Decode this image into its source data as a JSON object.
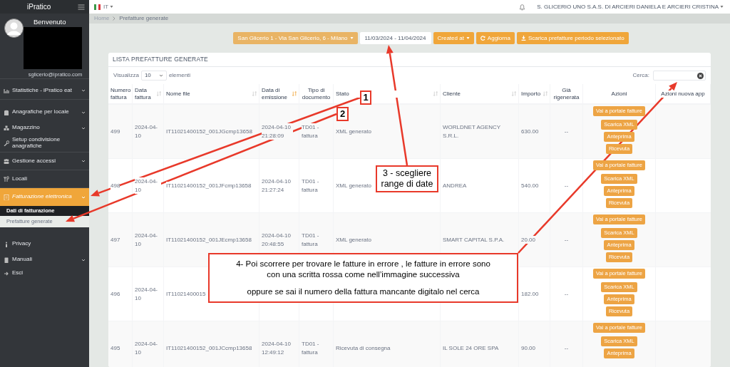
{
  "sidebar": {
    "logo": "iPratico",
    "welcome": "Benvenuto",
    "email": "sglicerio@ipratico.com",
    "items": [
      {
        "label": "Statistiche - iPratico eat",
        "has_submenu": true,
        "selected": false
      },
      {
        "label": "Anagrafiche per locale",
        "has_submenu": true,
        "selected": false
      },
      {
        "label": "Magazzino",
        "has_submenu": true,
        "selected": false
      },
      {
        "label": "Setup condivisione anagrafiche",
        "has_submenu": false,
        "selected": false
      },
      {
        "label": "Gestione accessi",
        "has_submenu": true,
        "selected": false
      },
      {
        "label": "Locali",
        "has_submenu": false,
        "selected": false
      },
      {
        "label": "Fatturazione elettronica",
        "has_submenu": true,
        "selected": true,
        "children": [
          {
            "label": "Dati di fatturazione",
            "selected": false
          },
          {
            "label": "Prefatture generate",
            "selected": true
          }
        ]
      },
      {
        "label": "Privacy",
        "has_submenu": false,
        "selected": false
      },
      {
        "label": "Manuali",
        "has_submenu": true,
        "selected": false
      },
      {
        "label": "Esci",
        "has_submenu": false,
        "selected": false
      }
    ]
  },
  "topbar": {
    "language": "IT",
    "company": "S. GLICERIO UNO S.A.S. DI ARCIERI DANIELA E ARCIERI CRISTINA"
  },
  "breadcrumb": [
    "Home",
    "Prefatture generate"
  ],
  "toolbar": {
    "location": "San Glicerio 1 - Via San Glicerio, 6 - Milano",
    "date_range": "11/03/2024 - 11/04/2024",
    "sort": "Created at",
    "refresh": "Aggiorna",
    "download": "Scarica prefatture periodo selezionato"
  },
  "card": {
    "title": "LISTA PREFATTURE GENERATE",
    "show_label": "Visualizza",
    "page_size": "10",
    "entries_label": "elementi",
    "search_label": "Cerca:",
    "columns": [
      {
        "label": "Numero fattura",
        "sortable": false,
        "sorted": false
      },
      {
        "label": "Data fattura",
        "sortable": true,
        "sorted": false
      },
      {
        "label": "Nome file",
        "sortable": true,
        "sorted": false
      },
      {
        "label": "Data di emissione",
        "sortable": true,
        "sorted": true
      },
      {
        "label": "Tipo di documento",
        "sortable": false,
        "sorted": false
      },
      {
        "label": "Stato",
        "sortable": true,
        "sorted": false
      },
      {
        "label": "Cliente",
        "sortable": true,
        "sorted": false
      },
      {
        "label": "Importo",
        "sortable": true,
        "sorted": false
      },
      {
        "label": "Già rigenerata",
        "sortable": false,
        "sorted": false
      },
      {
        "label": "Azioni",
        "sortable": false,
        "sorted": false
      },
      {
        "label": "Azioni nuova app",
        "sortable": false,
        "sorted": false
      }
    ],
    "rows": [
      {
        "cells": [
          "499",
          "2024-04-10",
          "IT11021400152_001JGcmp13658",
          "2024-04-10 21:28:09",
          "TD01 - fattura",
          "XML generato",
          "WORLDNET AGENCY S.R.L.",
          "630.00",
          "--"
        ],
        "actions": [
          "Vai a portale fatture",
          "Scarica XML",
          "Anteprima",
          "Ricevuta"
        ]
      },
      {
        "cells": [
          "498",
          "2024-04-10",
          "IT11021400152_001JFcmp13658",
          "2024-04-10 21:27:24",
          "TD01 - fattura",
          "XML generato",
          "ANDREA",
          "540.00",
          "--"
        ],
        "actions": [
          "Vai a portale fatture",
          "Scarica XML",
          "Anteprima",
          "Ricevuta"
        ]
      },
      {
        "cells": [
          "497",
          "2024-04-10",
          "IT11021400152_001JEcmp13658",
          "2024-04-10 20:48:55",
          "TD01 - fattura",
          "XML generato",
          "SMART CAPITAL S.P.A.",
          "20.00",
          "--"
        ],
        "actions": [
          "Vai a portale fatture",
          "Scarica XML",
          "Anteprima",
          "Ricevuta"
        ]
      },
      {
        "cells": [
          "496",
          "2024-04-10",
          "IT11021400015",
          null,
          null,
          null,
          null,
          "182.00",
          "--"
        ],
        "actions": [
          "Vai a portale fatture",
          "Scarica XML",
          "Anteprima",
          "Ricevuta"
        ]
      },
      {
        "cells": [
          "495",
          "2024-04-10",
          "IT11021400152_001JCcmp13658",
          "2024-04-10 12:49:12",
          "TD01 - fattura",
          "Ricevuta di consegna",
          "IL SOLE 24 ORE SPA",
          "90.00",
          "--"
        ],
        "actions": [
          "Vai a portale fatture",
          "Scarica XML",
          "Anteprima"
        ]
      }
    ]
  },
  "annotations": [
    {
      "kind": "number",
      "text": "1"
    },
    {
      "kind": "number",
      "text": "2"
    },
    {
      "kind": "note",
      "paragraphs": [
        [
          "3 - scegliere",
          "range di date"
        ]
      ]
    },
    {
      "kind": "note",
      "paragraphs": [
        [
          "4- Poi scorrere per trovare le fatture in errore , le fatture in errore sono",
          "con una scritta rossa come nell’immagine successiva"
        ],
        [
          "oppure se sai il numero della fattura mancante digitalo nel cerca"
        ]
      ]
    }
  ]
}
